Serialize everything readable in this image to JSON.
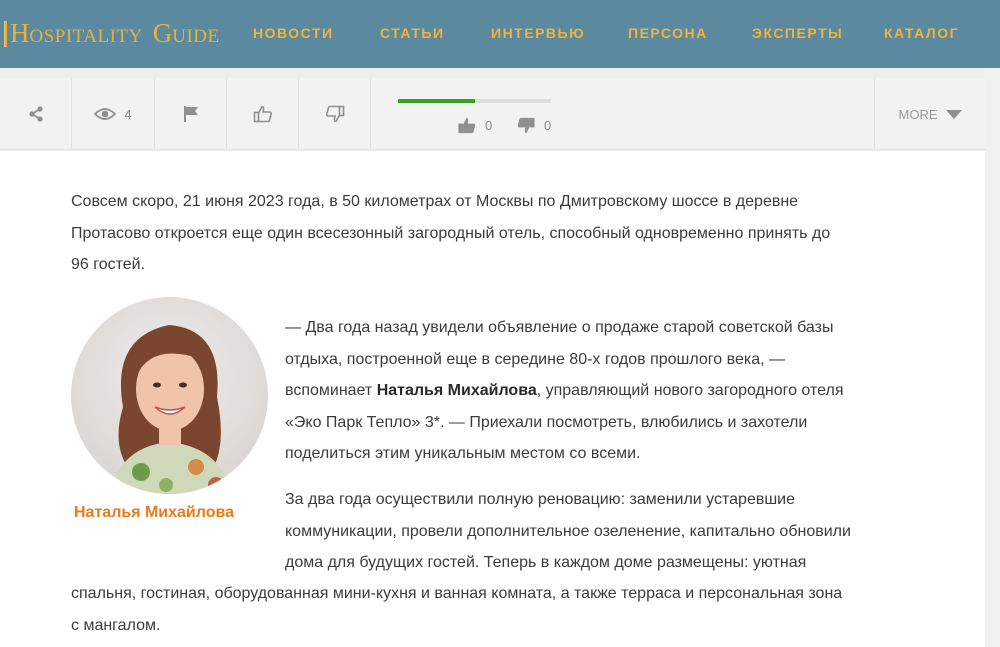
{
  "header": {
    "logo": {
      "h": "H",
      "ospitality": "OSPITALITY",
      "g": "G",
      "uide": "UIDE"
    },
    "nav": [
      "НОВОСТИ",
      "СТАТЬИ",
      "ИНТЕРВЬЮ",
      "ПЕРСОНА",
      "ЭКСПЕРТЫ",
      "КАТАЛОГ"
    ]
  },
  "toolbar": {
    "views": "4",
    "likes": "0",
    "dislikes": "0",
    "rating_fraction": 0.5,
    "more_label": "MORE"
  },
  "article": {
    "p1_line1": "Совсем скоро, 21 июня 2023 года, в 50 километрах от Москвы по Дмитровскому шоссе в деревне",
    "p1_line2": "Протасово откроется еще один всесезонный загородный отель, способный одновременно принять до",
    "p1_line3": "96 гостей.",
    "p2_line1": "— Два года назад увидели объявление о продаже старой советской базы",
    "p2_line2": "отдыха, построенной еще в середине 80-х годов прошлого века, —",
    "p2_line3a": "вспоминает ",
    "p2_name": "Наталья Михайлова",
    "p2_line3b": ", управляющий нового загородного отеля",
    "p2_line4": "«Эко Парк Тепло» 3*. — Приехали посмотреть, влюбились и захотели",
    "p2_line5": "поделиться этим уникальным местом со всеми.",
    "p3_line1": "За два года осуществили полную реновацию: заменили устаревшие",
    "p3_line2": "коммуникации, провели дополнительное озеленение, капитально обновили",
    "p3_line3": "дома для будущих гостей. Теперь в каждом доме размещены: уютная",
    "p3_line4": "спальня, гостиная, оборудованная мини-кухня и ванная комната, а также терраса и персональная зона",
    "p3_line5": "с мангалом.",
    "photo_caption": "Наталья Михайлова"
  },
  "icons": [
    "share-icon",
    "eye-icon",
    "flag-icon",
    "thumbs-up-icon",
    "thumbs-down-icon",
    "chevron-down-icon"
  ],
  "colors": {
    "header_bg": "#5b8aa0",
    "accent": "#f0b43a",
    "caption": "#e87b1e",
    "rating": "#3aa11c"
  }
}
